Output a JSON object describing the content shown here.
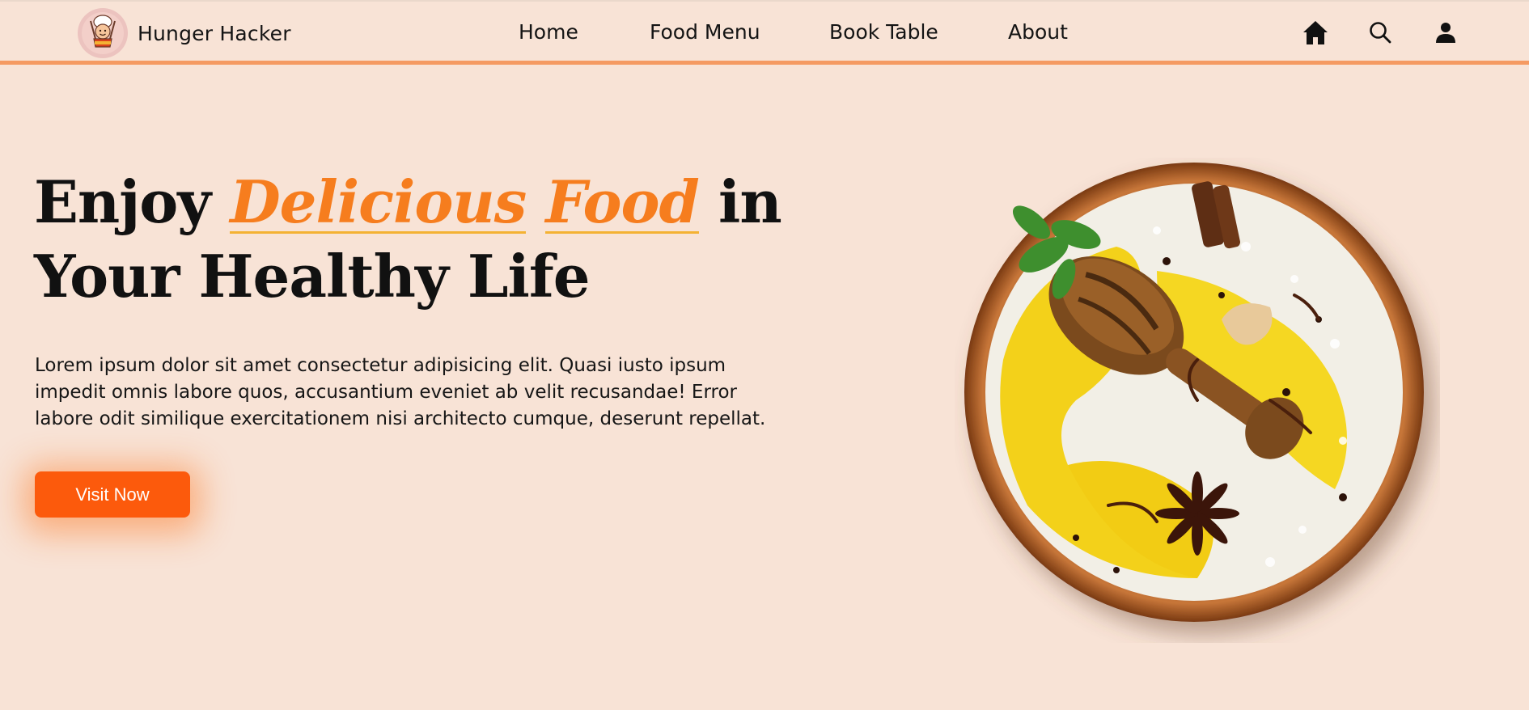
{
  "brand": {
    "name": "Hunger Hacker",
    "logo_icon": "chef-logo-icon"
  },
  "nav": {
    "items": [
      "Home",
      "Food Menu",
      "Book Table",
      "About"
    ]
  },
  "header_icons": [
    "home-icon",
    "search-icon",
    "user-icon"
  ],
  "hero": {
    "title_start": "Enjoy ",
    "title_accent_1": "Delicious",
    "title_accent_2": "Food",
    "title_end": " in",
    "title_line2": "Your Healthy Life",
    "description": "Lorem ipsum dolor sit amet consectetur adipisicing elit. Quasi iusto ipsum impedit omnis labore quos, accusantium eveniet ab velit recusandae! Error labore odit similique exercitationem nisi architecto cumque, deserunt repellat.",
    "cta_label": "Visit Now"
  },
  "colors": {
    "background": "#f8e3d6",
    "accent": "#f67d1e",
    "underline": "#f4b233",
    "header_border": "#f59a62",
    "cta": "#fc5a0c"
  }
}
